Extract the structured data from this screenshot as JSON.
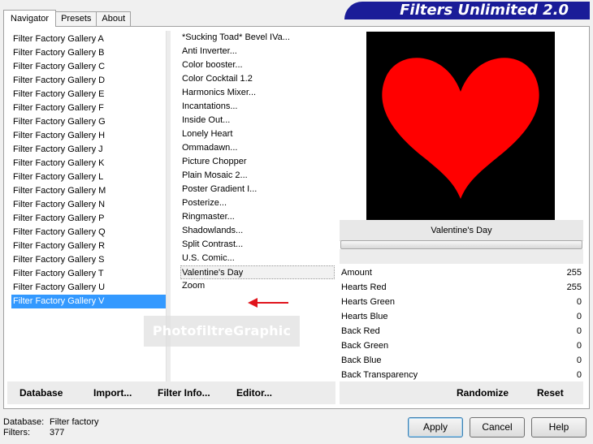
{
  "title": "Filters Unlimited 2.0",
  "tabs": [
    {
      "label": "Navigator",
      "active": true
    },
    {
      "label": "Presets",
      "active": false
    },
    {
      "label": "About",
      "active": false
    }
  ],
  "categories": [
    "Filter Factory Gallery A",
    "Filter Factory Gallery B",
    "Filter Factory Gallery C",
    "Filter Factory Gallery D",
    "Filter Factory Gallery E",
    "Filter Factory Gallery F",
    "Filter Factory Gallery G",
    "Filter Factory Gallery H",
    "Filter Factory Gallery J",
    "Filter Factory Gallery K",
    "Filter Factory Gallery L",
    "Filter Factory Gallery M",
    "Filter Factory Gallery N",
    "Filter Factory Gallery P",
    "Filter Factory Gallery Q",
    "Filter Factory Gallery R",
    "Filter Factory Gallery S",
    "Filter Factory Gallery T",
    "Filter Factory Gallery U",
    "Filter Factory Gallery V"
  ],
  "selected_category": "Filter Factory Gallery V",
  "filters": [
    "*Sucking Toad*  Bevel IVa...",
    "Anti Inverter...",
    "Color booster...",
    "Color Cocktail 1.2",
    "Harmonics Mixer...",
    "Incantations...",
    "Inside Out...",
    "Lonely Heart",
    "Ommadawn...",
    "Picture Chopper",
    "Plain Mosaic 2...",
    "Poster Gradient I...",
    "Posterize...",
    "Ringmaster...",
    "Shadowlands...",
    "Split Contrast...",
    "U.S. Comic...",
    "Valentine's Day",
    "Zoom"
  ],
  "selected_filter": "Valentine's Day",
  "watermark": "PhotofiltreGraphic",
  "preview": {
    "filter_name": "Valentine's Day",
    "background": "#000000",
    "heart_color": "#ff0000"
  },
  "progress": 0,
  "parameters": [
    {
      "name": "Amount",
      "value": "255"
    },
    {
      "name": "Hearts Red",
      "value": "255"
    },
    {
      "name": "Hearts Green",
      "value": "0"
    },
    {
      "name": "Hearts Blue",
      "value": "0"
    },
    {
      "name": "Back Red",
      "value": "0"
    },
    {
      "name": "Back Green",
      "value": "0"
    },
    {
      "name": "Back Blue",
      "value": "0"
    },
    {
      "name": "Back Transparency",
      "value": "0"
    }
  ],
  "left_buttons": {
    "database": "Database",
    "import": "Import...",
    "filter_info": "Filter Info...",
    "editor": "Editor..."
  },
  "right_buttons": {
    "randomize": "Randomize",
    "reset": "Reset"
  },
  "status": {
    "database_label": "Database:",
    "database_value": "Filter factory",
    "filters_label": "Filters:",
    "filters_value": "377"
  },
  "dialog_buttons": {
    "apply": "Apply",
    "cancel": "Cancel",
    "help": "Help"
  },
  "colors": {
    "banner": "#1a1c98",
    "selection": "#3399ff",
    "arrow": "#e0141c"
  }
}
